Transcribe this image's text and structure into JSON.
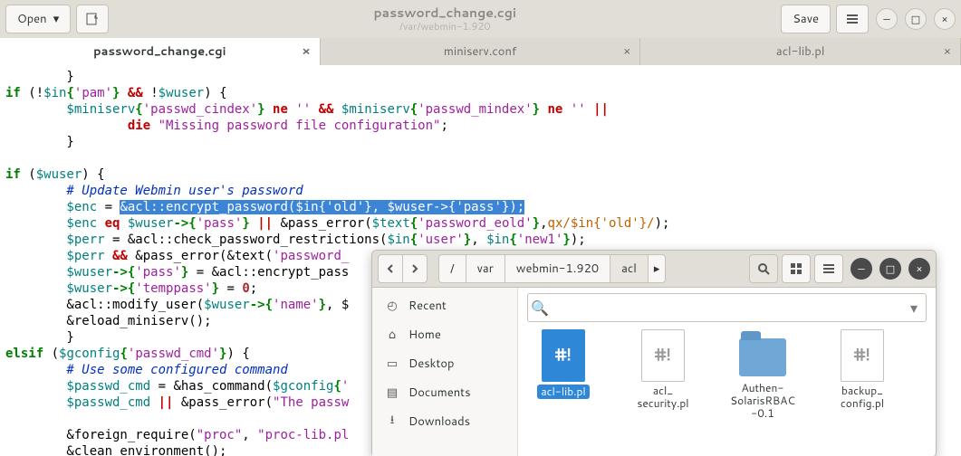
{
  "header": {
    "open": "Open",
    "save": "Save",
    "title": "password_change.cgi",
    "subtitle": "/var/webmin-1.920"
  },
  "tabs": [
    {
      "label": "password_change.cgi",
      "active": true
    },
    {
      "label": "miniserv.conf",
      "active": false
    },
    {
      "label": "acl-lib.pl",
      "active": false
    }
  ],
  "code": {
    "sel": "&acl::encrypt_password($in{'old'}, $wuser->{'pass'});",
    "l99_a": "if",
    "l99_b": " (!",
    "l99_c": "$in",
    "l99_d": "{",
    "l99_e": "'pam'",
    "l99_f": "}",
    "l99_g": " && ",
    "l99_h": "!",
    "l99_i": "$wuser",
    "l99_j": ") {",
    "l100a": "        $miniserv",
    "l100b": "{",
    "l100c": "'passwd_cindex'",
    "l100d": "}",
    "l100e": " ne ",
    "l100f": "''",
    "l100g": " && ",
    "l100h": "$miniserv",
    "l100i": "{",
    "l100j": "'passwd_mindex'",
    "l100k": "}",
    "l100l": " ne ",
    "l100m": "''",
    "l100n": " ||",
    "l101": "                die ",
    "l101s": "\"Missing password file configuration\"",
    "l101e": ";",
    "l105": "if",
    "l105b": " (",
    "l105c": "$wuser",
    "l105d": ") {",
    "l106": "        # Update Webmin user's password",
    "l107": "        $enc",
    "l107b": " = ",
    "l108": "        $enc",
    "l108b": " eq ",
    "l108c": "$wuser",
    "l108d": "->{",
    "l108e": "'pass'",
    "l108f": "}",
    "l108g": " || ",
    "l108h": "&pass_error(",
    "l108i": "$text",
    "l108j": "{",
    "l108k": "'password_eold'",
    "l108l": "}",
    "l108m": ",",
    "l108n": "qx/$in{'old'}/",
    "l108o": ");",
    "l109": "        $perr",
    "l109b": " = &acl::check_password_restrictions(",
    "l109c": "$in",
    "l109d": "{",
    "l109e": "'user'",
    "l109f": "}",
    "l109g": ", ",
    "l109h": "$in",
    "l109i": "{",
    "l109j": "'new1'",
    "l109k": "}",
    "l109l": ");",
    "l110": "        $perr",
    "l110b": " && ",
    "l110c": "&pass_error(&text(",
    "l110d": "'password_",
    "l111": "        $wuser",
    "l111b": "->{",
    "l111c": "'pass'",
    "l111d": "}",
    "l111e": " = &acl::encrypt_pass",
    "l112": "        $wuser",
    "l112b": "->{",
    "l112c": "'temppass'",
    "l112d": "}",
    "l112e": " = ",
    "l112f": "0",
    "l112g": ";",
    "l113": "        &acl::modify_user(",
    "l113b": "$wuser",
    "l113c": "->{",
    "l113d": "'name'",
    "l113e": "}",
    "l113f": ", $",
    "l114": "        &reload_miniserv();",
    "l116": "elsif",
    "l116b": " (",
    "l116c": "$gconfig",
    "l116d": "{",
    "l116e": "'passwd_cmd'",
    "l116f": "}",
    "l116g": ") {",
    "l117": "        # Use some configured command",
    "l118": "        $passwd_cmd",
    "l118b": " = &has_command(",
    "l118c": "$gconfig",
    "l118d": "{",
    "l118e": "'",
    "l119": "        $passwd_cmd",
    "l119b": " || ",
    "l119c": "&pass_error(",
    "l119d": "\"The passw",
    "l121": "        &foreign_require(",
    "l121b": "\"proc\"",
    "l121c": ", ",
    "l121d": "\"proc-lib.pl",
    "l122": "        &clean_environment();"
  },
  "files": {
    "breadcrumbs": [
      "/",
      "var",
      "webmin-1.920",
      "acl"
    ],
    "sidebar": [
      {
        "icon": "clock",
        "label": "Recent"
      },
      {
        "icon": "home",
        "label": "Home"
      },
      {
        "icon": "desktop",
        "label": "Desktop"
      },
      {
        "icon": "docs",
        "label": "Documents"
      },
      {
        "icon": "down",
        "label": "Downloads"
      }
    ],
    "items": [
      {
        "type": "file",
        "label": "acl-lib.pl",
        "selected": true
      },
      {
        "type": "file",
        "label": "acl_\nsecurity.pl"
      },
      {
        "type": "folder",
        "label": "Authen-\nSolarisRBAC\n-0.1"
      },
      {
        "type": "file",
        "label": "backup_\nconfig.pl"
      }
    ]
  }
}
